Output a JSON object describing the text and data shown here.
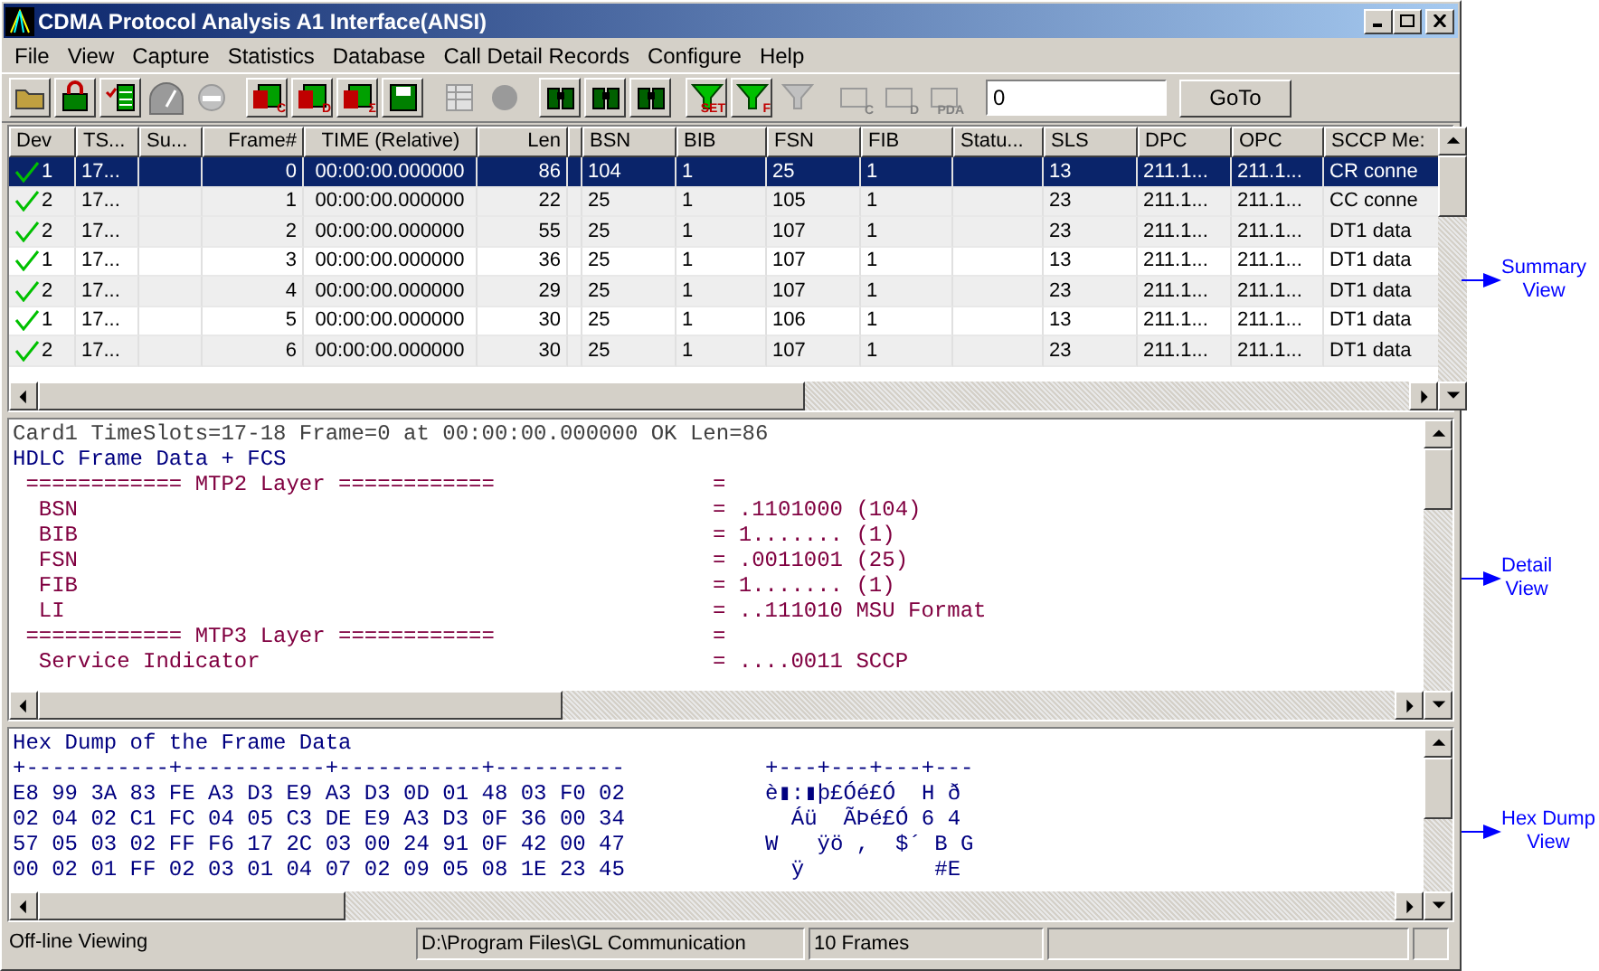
{
  "window": {
    "title": "CDMA Protocol Analysis A1 Interface(ANSI)"
  },
  "menu": [
    "File",
    "View",
    "Capture",
    "Statistics",
    "Database",
    "Call Detail Records",
    "Configure",
    "Help"
  ],
  "toolbar": [
    {
      "kind": "folder",
      "disabled": false
    },
    {
      "kind": "lock",
      "disabled": false
    },
    {
      "kind": "list",
      "disabled": false
    },
    {
      "kind": "gauge",
      "disabled": true
    },
    {
      "kind": "stop",
      "disabled": true
    },
    {
      "kind": "letter",
      "glyph": "C",
      "disabled": false
    },
    {
      "kind": "letter",
      "glyph": "D",
      "disabled": false
    },
    {
      "kind": "letter",
      "glyph": "Σ",
      "disabled": false
    },
    {
      "kind": "save",
      "disabled": false
    },
    {
      "kind": "table",
      "disabled": true
    },
    {
      "kind": "circle",
      "disabled": true
    },
    {
      "kind": "binoculars",
      "disabled": false
    },
    {
      "kind": "binoculars",
      "disabled": false
    },
    {
      "kind": "binoculars",
      "disabled": false
    },
    {
      "kind": "filter",
      "glyph": "SET",
      "disabled": false
    },
    {
      "kind": "filter",
      "glyph": "F",
      "disabled": false
    },
    {
      "kind": "filter",
      "disabled": true
    },
    {
      "kind": "letter",
      "glyph": "C",
      "disabled": true
    },
    {
      "kind": "letter",
      "glyph": "D",
      "disabled": true
    },
    {
      "kind": "letter",
      "glyph": "PDA",
      "disabled": true
    }
  ],
  "goto": {
    "value": "0",
    "button": "GoTo"
  },
  "table": {
    "columns": [
      "Dev",
      "TS...",
      "Su...",
      "Frame#",
      "TIME (Relative)",
      "Len",
      "",
      "BSN",
      "BIB",
      "FSN",
      "FIB",
      "Statu...",
      "SLS",
      "DPC",
      "OPC",
      "SCCP Me:"
    ],
    "rows": [
      {
        "selected": true,
        "shaded": false,
        "cells": [
          "1",
          "17...",
          "",
          "0",
          "00:00:00.000000",
          "86",
          "",
          "104",
          "1",
          "25",
          "1",
          "",
          "13",
          "211.1...",
          "211.1...",
          "CR conne"
        ]
      },
      {
        "selected": false,
        "shaded": true,
        "cells": [
          "2",
          "17...",
          "",
          "1",
          "00:00:00.000000",
          "22",
          "",
          "25",
          "1",
          "105",
          "1",
          "",
          "23",
          "211.1...",
          "211.1...",
          "CC conne"
        ]
      },
      {
        "selected": false,
        "shaded": true,
        "cells": [
          "2",
          "17...",
          "",
          "2",
          "00:00:00.000000",
          "55",
          "",
          "25",
          "1",
          "107",
          "1",
          "",
          "23",
          "211.1...",
          "211.1...",
          "DT1 data"
        ]
      },
      {
        "selected": false,
        "shaded": false,
        "cells": [
          "1",
          "17...",
          "",
          "3",
          "00:00:00.000000",
          "36",
          "",
          "25",
          "1",
          "107",
          "1",
          "",
          "13",
          "211.1...",
          "211.1...",
          "DT1 data"
        ]
      },
      {
        "selected": false,
        "shaded": true,
        "cells": [
          "2",
          "17...",
          "",
          "4",
          "00:00:00.000000",
          "29",
          "",
          "25",
          "1",
          "107",
          "1",
          "",
          "23",
          "211.1...",
          "211.1...",
          "DT1 data"
        ]
      },
      {
        "selected": false,
        "shaded": false,
        "cells": [
          "1",
          "17...",
          "",
          "5",
          "00:00:00.000000",
          "30",
          "",
          "25",
          "1",
          "106",
          "1",
          "",
          "13",
          "211.1...",
          "211.1...",
          "DT1 data"
        ]
      },
      {
        "selected": false,
        "shaded": true,
        "cells": [
          "2",
          "17...",
          "",
          "6",
          "00:00:00.000000",
          "30",
          "",
          "25",
          "1",
          "107",
          "1",
          "",
          "23",
          "211.1...",
          "211.1...",
          "DT1 data"
        ]
      }
    ]
  },
  "detail": {
    "lines": [
      {
        "kind": "info",
        "text": "Card1 TimeSlots=17-18 Frame=0 at 00:00:00.000000 OK Len=86"
      },
      {
        "kind": "heading",
        "text": "HDLC Frame Data + FCS"
      },
      {
        "kind": "field",
        "label": " ============ MTP2 Layer ============",
        "value": "="
      },
      {
        "kind": "field",
        "label": "  BSN",
        "value": "= .1101000 (104)"
      },
      {
        "kind": "field",
        "label": "  BIB",
        "value": "= 1....... (1)"
      },
      {
        "kind": "field",
        "label": "  FSN",
        "value": "= .0011001 (25)"
      },
      {
        "kind": "field",
        "label": "  FIB",
        "value": "= 1....... (1)"
      },
      {
        "kind": "field",
        "label": "  LI",
        "value": "= ..111010 MSU Format"
      },
      {
        "kind": "field",
        "label": " ============ MTP3 Layer ============",
        "value": "="
      },
      {
        "kind": "field",
        "label": "  Service Indicator",
        "value": "= ....0011 SCCP"
      }
    ]
  },
  "hexdump": {
    "title": "Hex Dump of the Frame Data",
    "lines": [
      {
        "hex": "+-----------+-----------+-----------+----------",
        "ascii": "+---+---+---+---"
      },
      {
        "hex": "E8 99 3A 83 FE A3 D3 E9 A3 D3 0D 01 48 03 F0 02",
        "ascii": "è▮:▮þ£Óé£Ó  H ð"
      },
      {
        "hex": "02 04 02 C1 FC 04 05 C3 DE E9 A3 D3 0F 36 00 34",
        "ascii": "  Áü  ÃÞé£Ó 6 4"
      },
      {
        "hex": "57 05 03 02 FF F6 17 2C 03 00 24 91 0F 42 00 47",
        "ascii": "W   ÿö ,  $´ B G"
      },
      {
        "hex": "00 02 01 FF 02 03 01 04 07 02 09 05 08 1E 23 45",
        "ascii": "  ÿ          #E"
      }
    ]
  },
  "status_bar": [
    "Off-line Viewing",
    "D:\\Program Files\\GL Communication",
    "10 Frames"
  ],
  "annotations": [
    {
      "line1": "Summary",
      "line2": "View"
    },
    {
      "line1": "Detail",
      "line2": "View"
    },
    {
      "line1": "Hex Dump",
      "line2": "View"
    }
  ]
}
